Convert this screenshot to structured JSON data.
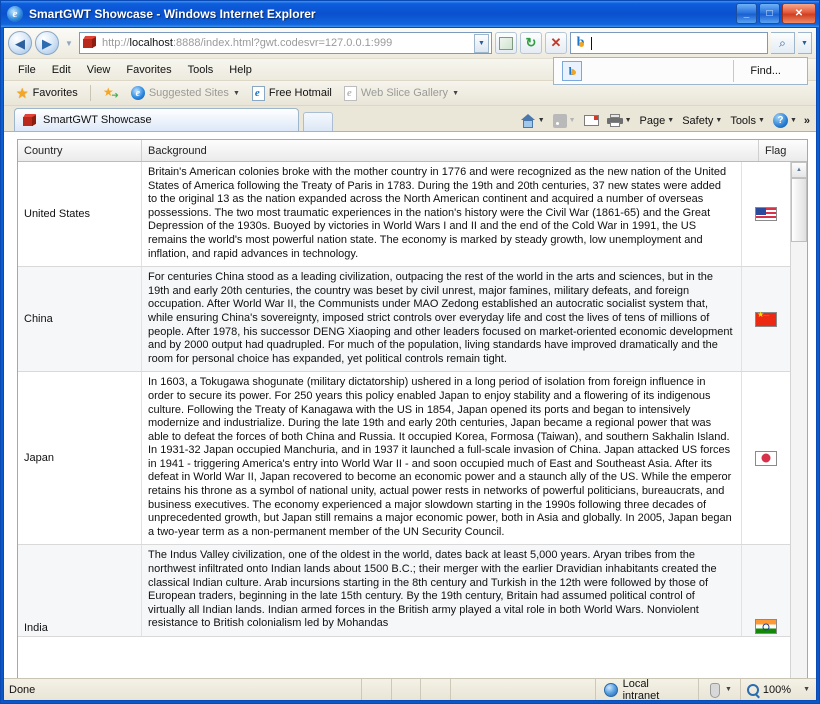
{
  "window": {
    "title": "SmartGWT Showcase - Windows Internet Explorer",
    "title_icon": "ie-logo-icon",
    "minimize_label": "_",
    "maximize_label": "□",
    "close_label": "✕"
  },
  "nav": {
    "back_label": "◀",
    "forward_label": "▶",
    "recent_caret": "▼",
    "address_icon": "gwt-box-icon",
    "address_scheme": "http://",
    "address_host": "localhost",
    "address_rest": ":8888/index.html?gwt.codesvr=127.0.0.1:999",
    "address_dropdown_caret": "▼",
    "compat_view_title": "Compatibility View",
    "refresh_label": "↻",
    "stop_label": "✕",
    "search_value": "",
    "search_icon": "bing-icon",
    "search_go_label": "⌕",
    "search_dropdown_caret": "▼"
  },
  "menubar": {
    "items": [
      "File",
      "Edit",
      "View",
      "Favorites",
      "Tools",
      "Help"
    ]
  },
  "find_overlay": {
    "provider_icon": "bing-icon",
    "find_label": "Find..."
  },
  "favbar": {
    "favorites_label": "Favorites",
    "items": [
      {
        "label": "Suggested Sites",
        "dim": true,
        "caret": "▼",
        "icon": "ie-logo-icon"
      },
      {
        "label": "Free Hotmail",
        "dim": false,
        "caret": "",
        "icon": "ie-document-icon"
      },
      {
        "label": "Web Slice Gallery",
        "dim": true,
        "caret": "▼",
        "icon": "ie-document-icon"
      }
    ]
  },
  "tabs": {
    "active": {
      "label": "SmartGWT Showcase",
      "icon": "gwt-box-icon"
    },
    "new_tab_label": ""
  },
  "cmdbar": {
    "home_label": "",
    "home_caret": "▼",
    "feeds_caret": "▼",
    "mail_caret": "▼",
    "print_caret": "▼",
    "page_label": "Page",
    "page_caret": "▼",
    "safety_label": "Safety",
    "safety_caret": "▼",
    "tools_label": "Tools",
    "tools_caret": "▼",
    "help_label": "?",
    "help_caret": "▼",
    "overflow_label": "»"
  },
  "grid": {
    "columns": [
      "Country",
      "Background",
      "Flag"
    ],
    "rows": [
      {
        "country": "United States",
        "flag": "flag-us",
        "background": "Britain's American colonies broke with the mother country in 1776 and were recognized as the new nation of the United States of America following the Treaty of Paris in 1783. During the 19th and 20th centuries, 37 new states were added to the original 13 as the nation expanded across the North American continent and acquired a number of overseas possessions. The two most traumatic experiences in the nation's history were the Civil War (1861-65) and the Great Depression of the 1930s. Buoyed by victories in World Wars I and II and the end of the Cold War in 1991, the US remains the world's most powerful nation state. The economy is marked by steady growth, low unemployment and inflation, and rapid advances in technology."
      },
      {
        "country": "China",
        "flag": "flag-cn",
        "background": "For centuries China stood as a leading civilization, outpacing the rest of the world in the arts and sciences, but in the 19th and early 20th centuries, the country was beset by civil unrest, major famines, military defeats, and foreign occupation. After World War II, the Communists under MAO Zedong established an autocratic socialist system that, while ensuring China's sovereignty, imposed strict controls over everyday life and cost the lives of tens of millions of people. After 1978, his successor DENG Xiaoping and other leaders focused on market-oriented economic development and by 2000 output had quadrupled. For much of the population, living standards have improved dramatically and the room for personal choice has expanded, yet political controls remain tight."
      },
      {
        "country": "Japan",
        "flag": "flag-jp",
        "background": "In 1603, a Tokugawa shogunate (military dictatorship) ushered in a long period of isolation from foreign influence in order to secure its power. For 250 years this policy enabled Japan to enjoy stability and a flowering of its indigenous culture. Following the Treaty of Kanagawa with the US in 1854, Japan opened its ports and began to intensively modernize and industrialize. During the late 19th and early 20th centuries, Japan became a regional power that was able to defeat the forces of both China and Russia. It occupied Korea, Formosa (Taiwan), and southern Sakhalin Island. In 1931-32 Japan occupied Manchuria, and in 1937 it launched a full-scale invasion of China. Japan attacked US forces in 1941 - triggering America's entry into World War II - and soon occupied much of East and Southeast Asia. After its defeat in World War II, Japan recovered to become an economic power and a staunch ally of the US. While the emperor retains his throne as a symbol of national unity, actual power rests in networks of powerful politicians, bureaucrats, and business executives. The economy experienced a major slowdown starting in the 1990s following three decades of unprecedented growth, but Japan still remains a major economic power, both in Asia and globally. In 2005, Japan began a two-year term as a non-permanent member of the UN Security Council."
      },
      {
        "country": "India",
        "flag": "flag-in",
        "background": "The Indus Valley civilization, one of the oldest in the world, dates back at least 5,000 years. Aryan tribes from the northwest infiltrated onto Indian lands about 1500 B.C.; their merger with the earlier Dravidian inhabitants created the classical Indian culture. Arab incursions starting in the 8th century and Turkish in the 12th were followed by those of European traders, beginning in the late 15th century. By the 19th century, Britain had assumed political control of virtually all Indian lands. Indian armed forces in the British army played a vital role in both World Wars. Nonviolent resistance to British colonialism led by Mohandas"
      }
    ],
    "scrollbar": {
      "up_label": "▲",
      "down_label": "▼"
    }
  },
  "statusbar": {
    "status_text": "Done",
    "zone_label": "Local intranet",
    "zone_icon": "globe-icon",
    "protected_icon": "protected-mode-icon",
    "protected_caret": "▼",
    "zoom_icon": "zoom-icon",
    "zoom_level": "100%",
    "zoom_caret": "▼"
  },
  "colors": {
    "titlebar_blue": "#0a58c8",
    "accent": "#1878cf",
    "row_alt": "#f5f7f9"
  }
}
